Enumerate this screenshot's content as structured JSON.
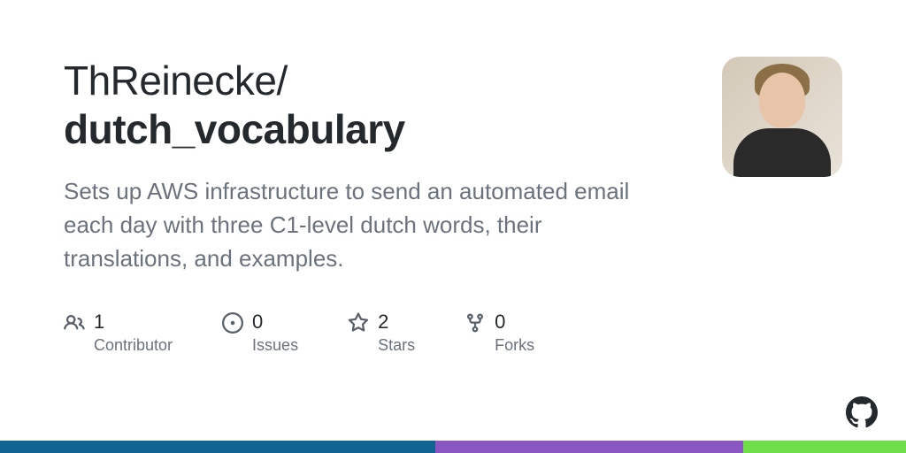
{
  "owner": "ThReinecke/",
  "repo": "dutch_vocabulary",
  "description": "Sets up AWS infrastructure to send an automated email each day with three C1-level dutch words, their translations, and examples.",
  "stats": {
    "contributors": {
      "value": "1",
      "label": "Contributor"
    },
    "issues": {
      "value": "0",
      "label": "Issues"
    },
    "stars": {
      "value": "2",
      "label": "Stars"
    },
    "forks": {
      "value": "0",
      "label": "Forks"
    }
  },
  "colors": {
    "bar": [
      {
        "color": "#116391",
        "width": "48%"
      },
      {
        "color": "#8a56c2",
        "width": "34%"
      },
      {
        "color": "#6fdc4a",
        "width": "18%"
      }
    ]
  }
}
